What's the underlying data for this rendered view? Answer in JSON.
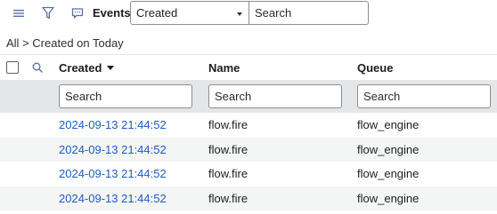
{
  "toolbar": {
    "title": "Events",
    "field_select_value": "Created",
    "search_placeholder": "Search",
    "icons": [
      "menu-icon",
      "filter-icon",
      "chat-icon"
    ]
  },
  "breadcrumb": {
    "root": "All",
    "separator": ">",
    "current": "Created on Today"
  },
  "table": {
    "columns": [
      {
        "label": "Created",
        "sorted": "descending"
      },
      {
        "label": "Name"
      },
      {
        "label": "Queue"
      }
    ],
    "filter_placeholders": [
      "Search",
      "Search",
      "Search"
    ],
    "rows": [
      {
        "created": "2024-09-13 21:44:52",
        "name": "flow.fire",
        "queue": "flow_engine"
      },
      {
        "created": "2024-09-13 21:44:52",
        "name": "flow.fire",
        "queue": "flow_engine"
      },
      {
        "created": "2024-09-13 21:44:52",
        "name": "flow.fire",
        "queue": "flow_engine"
      },
      {
        "created": "2024-09-13 21:44:52",
        "name": "flow.fire",
        "queue": "flow_engine"
      }
    ]
  },
  "colors": {
    "link": "#1f5bc9",
    "filter_row_bg": "#e4e6e7",
    "alt_row_bg": "#f4f5f5",
    "icon": "#5a6ea8"
  }
}
